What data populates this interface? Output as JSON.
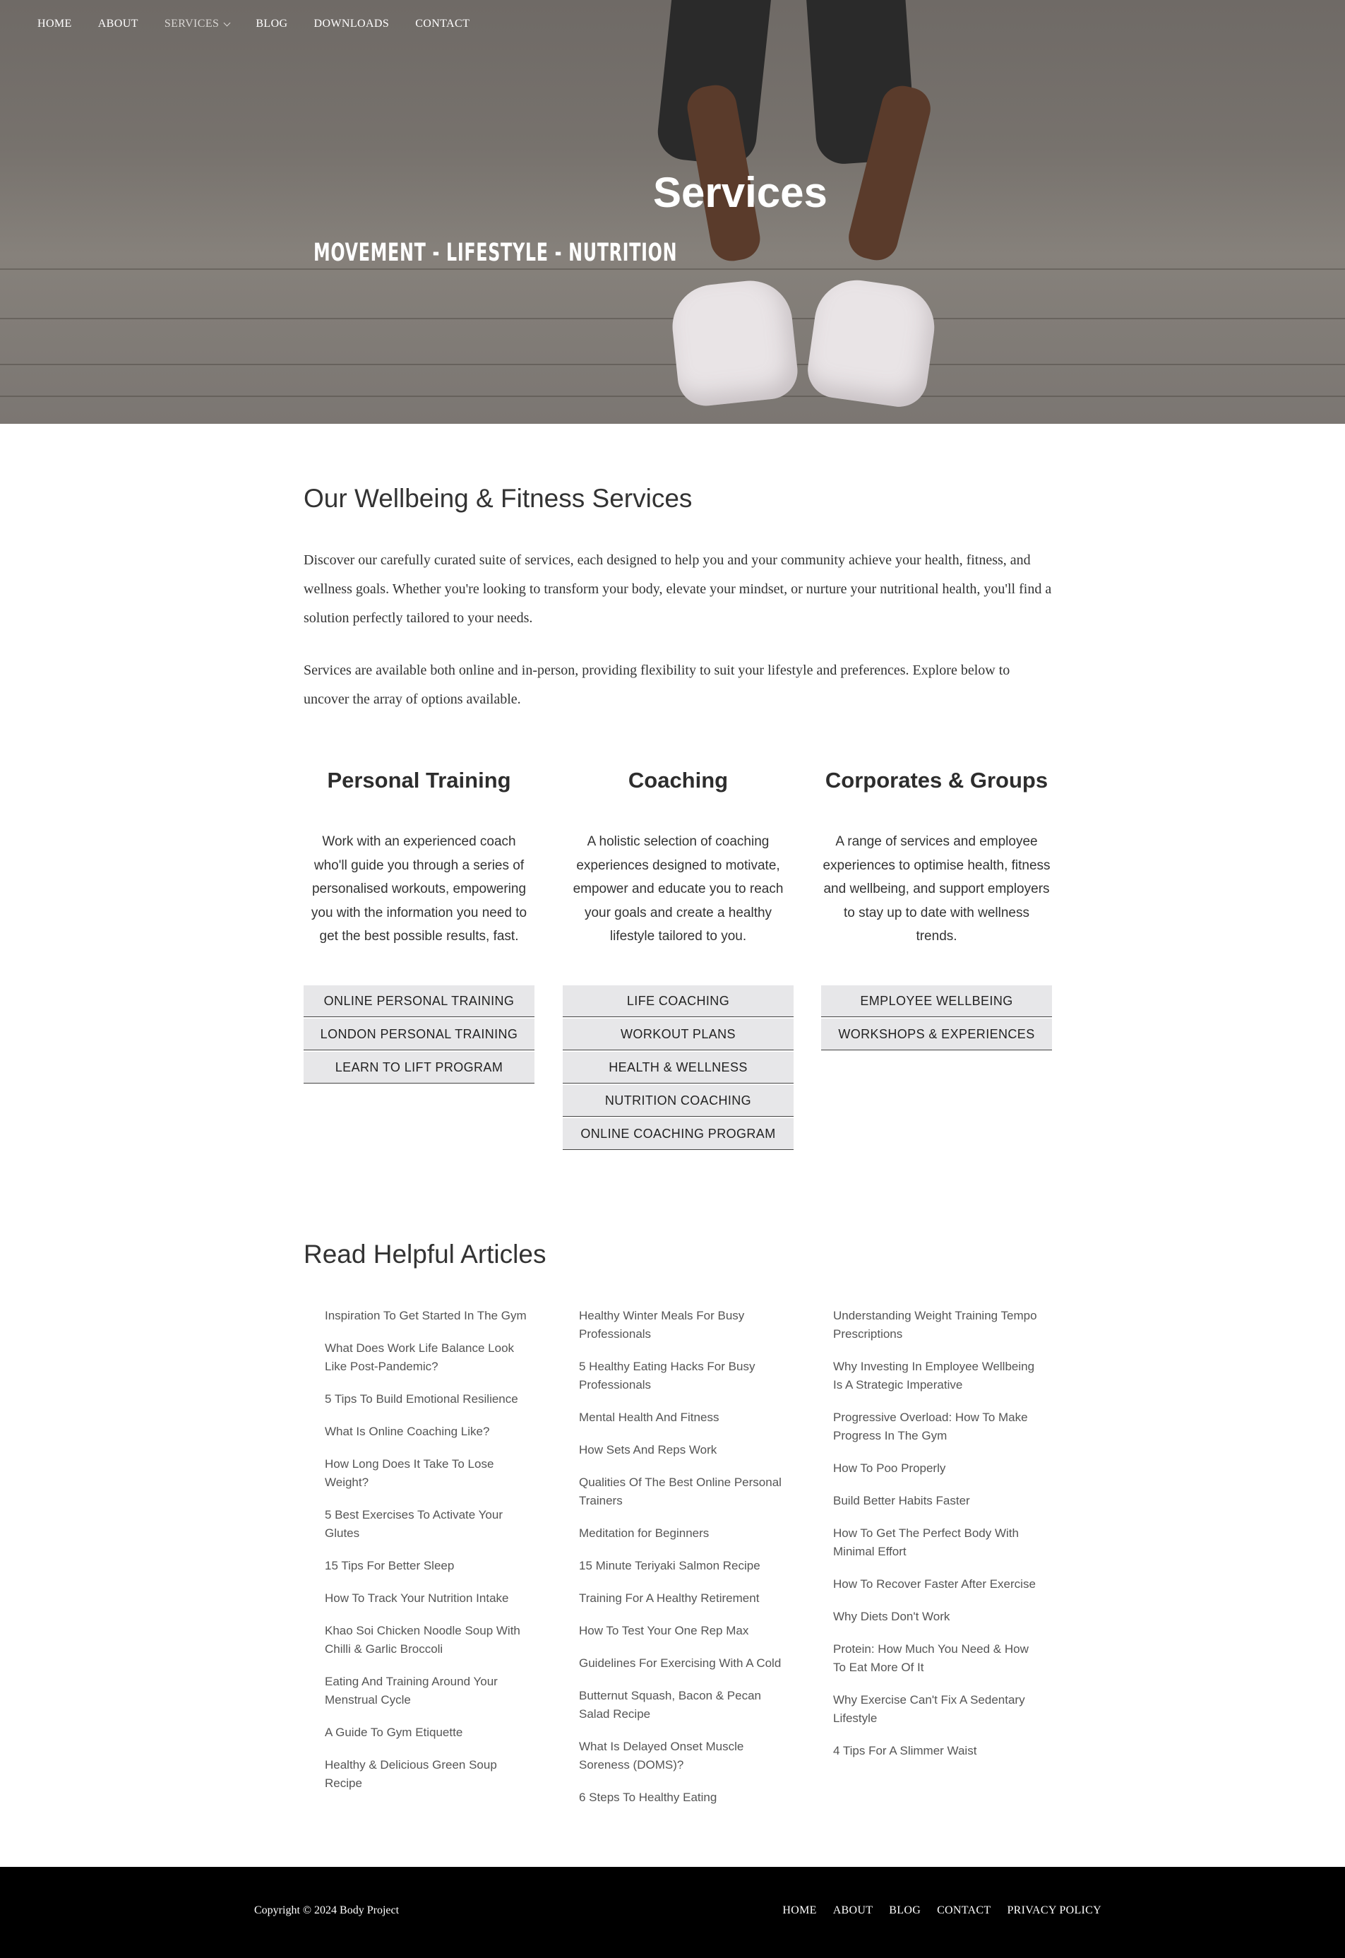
{
  "nav": {
    "items": [
      {
        "label": "HOME"
      },
      {
        "label": "ABOUT"
      },
      {
        "label": "SERVICES"
      },
      {
        "label": "BLOG"
      },
      {
        "label": "DOWNLOADS"
      },
      {
        "label": "CONTACT"
      }
    ]
  },
  "hero": {
    "title": "Services",
    "subtitle": "MOVEMENT - LIFESTYLE - NUTRITION"
  },
  "intro": {
    "heading": "Our Wellbeing & Fitness Services",
    "paragraph1": "Discover our carefully curated suite of services, each designed to help you and your community achieve your health, fitness, and wellness goals. Whether you're looking to transform your body, elevate your mindset, or nurture your nutritional health, you'll find a solution perfectly tailored to your needs.",
    "paragraph2": "Services are available both online and in-person, providing flexibility to suit your lifestyle and preferences. Explore below to uncover the array of options available."
  },
  "services": [
    {
      "title": "Personal Training",
      "description": "Work with an experienced coach who'll guide you through a series of personalised workouts, empowering you with the information you need to get the best possible results, fast.",
      "buttons": [
        "ONLINE PERSONAL TRAINING",
        "LONDON PERSONAL TRAINING",
        "LEARN TO LIFT PROGRAM"
      ]
    },
    {
      "title": "Coaching",
      "description": "A holistic selection of coaching experiences designed to motivate, empower and educate you to reach your goals and create a healthy lifestyle tailored to you.",
      "buttons": [
        "LIFE COACHING",
        "WORKOUT PLANS",
        "HEALTH & WELLNESS",
        "NUTRITION COACHING",
        "ONLINE COACHING PROGRAM"
      ]
    },
    {
      "title": "Corporates & Groups",
      "description": "A range of services and employee experiences to optimise health, fitness and wellbeing, and support employers to stay up to date with wellness trends.",
      "buttons": [
        "EMPLOYEE WELLBEING",
        "WORKSHOPS & EXPERIENCES"
      ]
    }
  ],
  "articles": {
    "heading": "Read Helpful Articles",
    "columns": [
      [
        "Inspiration To Get Started In The Gym",
        "What Does Work Life Balance Look Like Post-Pandemic?",
        "5 Tips To Build Emotional Resilience",
        "What Is Online Coaching Like?",
        "How Long Does It Take To Lose Weight?",
        "5 Best Exercises To Activate Your Glutes",
        "15 Tips For Better Sleep",
        "How To Track Your Nutrition Intake",
        "Khao Soi Chicken Noodle Soup With Chilli & Garlic Broccoli",
        "Eating And Training Around Your Menstrual Cycle",
        "A Guide To Gym Etiquette",
        "Healthy & Delicious Green Soup Recipe"
      ],
      [
        "Healthy Winter Meals For Busy Professionals",
        "5 Healthy Eating Hacks For Busy Professionals",
        "Mental Health And Fitness",
        "How Sets And Reps Work",
        "Qualities Of The Best Online Personal Trainers",
        "Meditation for Beginners",
        "15 Minute Teriyaki Salmon Recipe",
        "Training For A Healthy Retirement",
        "How To Test Your One Rep Max",
        "Guidelines For Exercising With A Cold",
        "Butternut Squash, Bacon & Pecan Salad Recipe",
        "What Is Delayed Onset Muscle Soreness (DOMS)?",
        "6 Steps To Healthy Eating"
      ],
      [
        "Understanding Weight Training Tempo Prescriptions",
        "Why Investing In Employee Wellbeing Is A Strategic Imperative",
        "Progressive Overload: How To Make Progress In The Gym",
        "How To Poo Properly",
        "Build Better Habits Faster",
        "How To Get The Perfect Body With Minimal Effort",
        "How To Recover Faster After Exercise",
        "Why Diets Don't Work",
        "Protein: How Much You Need & How To Eat More Of It",
        "Why Exercise Can't Fix A Sedentary Lifestyle",
        "4 Tips For A Slimmer Waist"
      ]
    ]
  },
  "footer": {
    "copyright": "Copyright © 2024 Body Project",
    "links": [
      "HOME",
      "ABOUT",
      "BLOG",
      "CONTACT",
      "PRIVACY POLICY"
    ]
  }
}
